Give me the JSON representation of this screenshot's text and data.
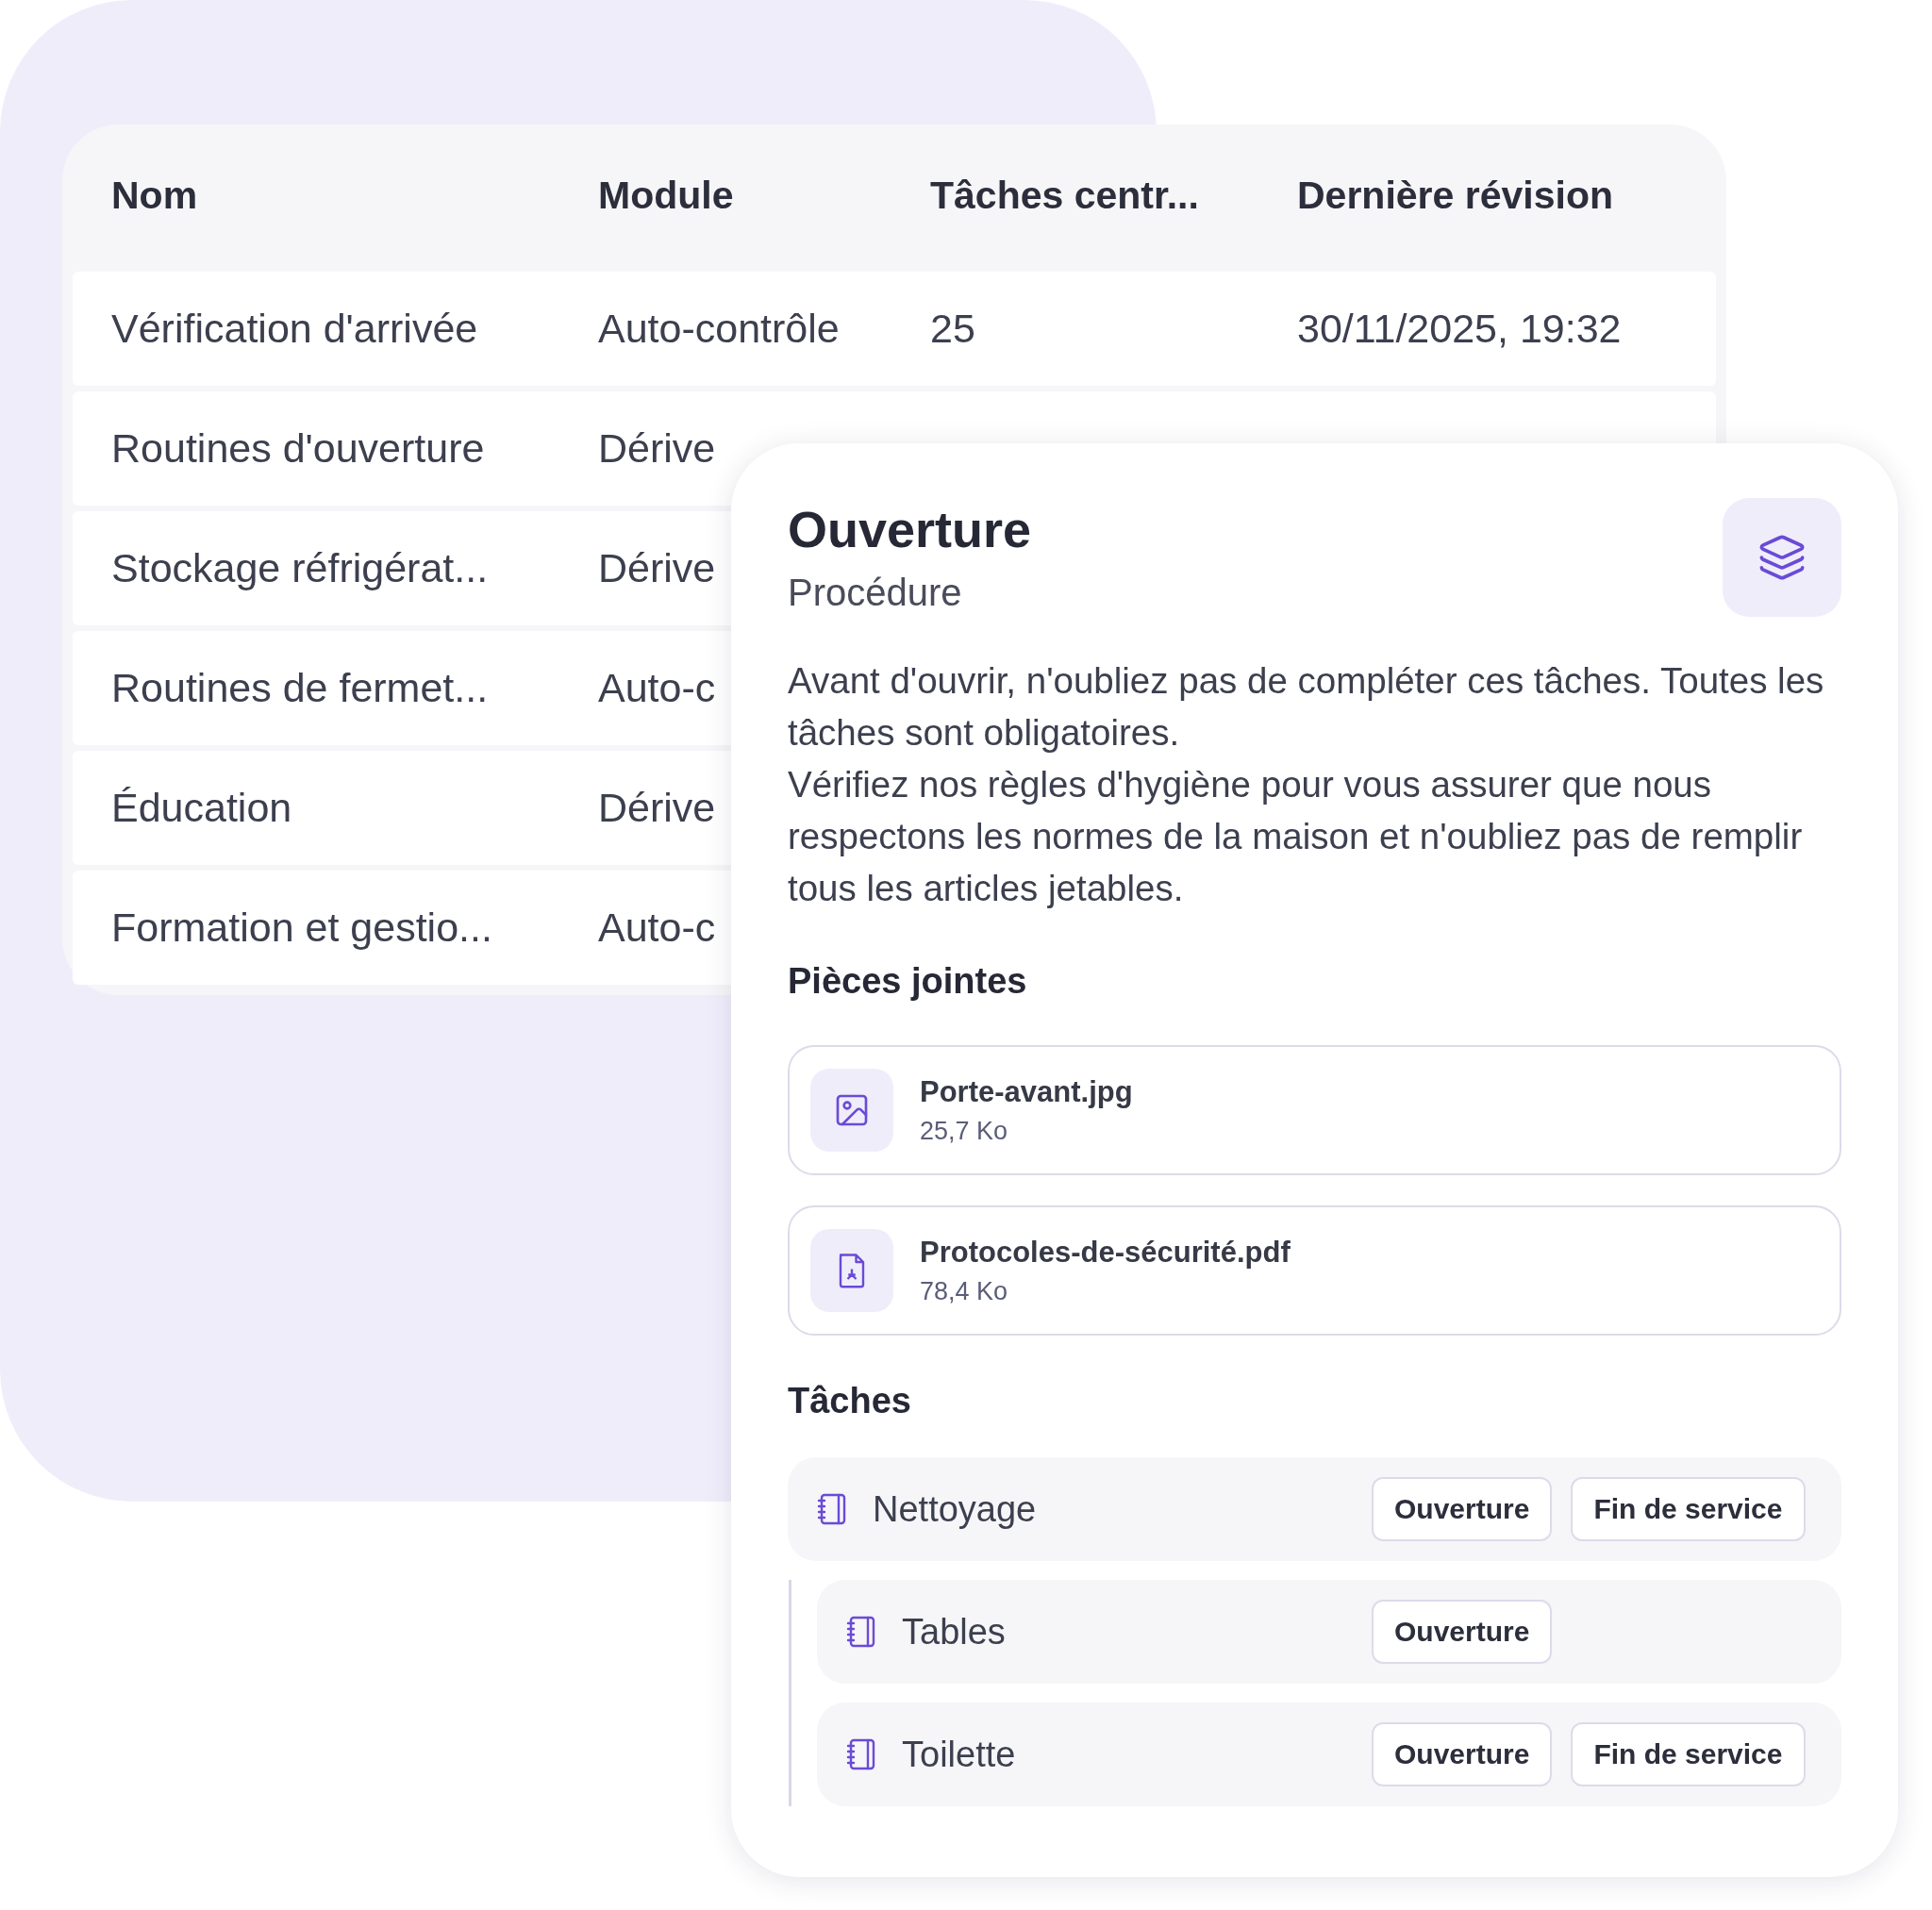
{
  "table": {
    "columns": [
      "Nom",
      "Module",
      "Tâches centr...",
      "Dernière révision"
    ],
    "rows": [
      {
        "cells": [
          "Vérification d'arrivée",
          "Auto-contrôle",
          "25",
          "30/11/2025, 19:32"
        ]
      },
      {
        "cells": [
          "Routines d'ouverture",
          "Dérive"
        ]
      },
      {
        "cells": [
          "Stockage réfrigérat...",
          "Dérive"
        ]
      },
      {
        "cells": [
          "Routines de fermet...",
          "Auto-c"
        ]
      },
      {
        "cells": [
          "Éducation",
          "Dérive"
        ]
      },
      {
        "cells": [
          "Formation et gestio...",
          "Auto-c"
        ]
      }
    ]
  },
  "card": {
    "title": "Ouverture",
    "subtitle": "Procédure",
    "description": [
      "Avant d'ouvrir, n'oubliez pas de compléter ces tâches. Toutes les tâches sont obligatoires.",
      "Vérifiez nos règles d'hygiène pour vous assurer que nous respectons les normes de la maison et n'oubliez pas de remplir tous les articles jetables."
    ],
    "attachments_heading": "Pièces jointes",
    "attachments": [
      {
        "kind": "image",
        "name": "Porte-avant.jpg",
        "size": "25,7 Ko"
      },
      {
        "kind": "pdf",
        "name": "Protocoles-de-sécurité.pdf",
        "size": "78,4 Ko"
      }
    ],
    "tasks_heading": "Tâches",
    "tasks": [
      {
        "name": "Nettoyage",
        "tags": [
          "Ouverture",
          "Fin de service"
        ],
        "children": [
          {
            "name": "Tables",
            "tags": [
              "Ouverture"
            ]
          },
          {
            "name": "Toilette",
            "tags": [
              "Ouverture",
              "Fin de service"
            ]
          }
        ]
      }
    ]
  }
}
